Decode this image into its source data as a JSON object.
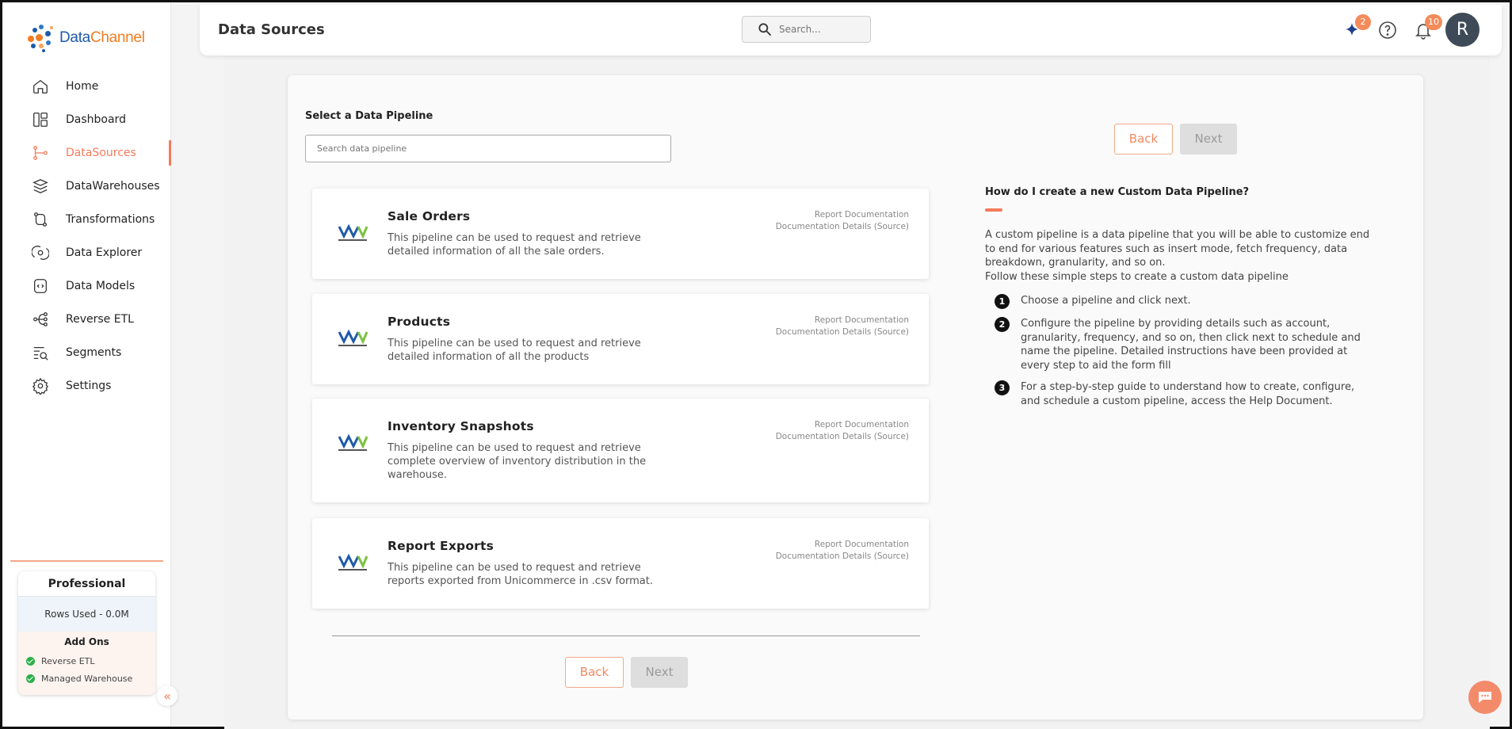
{
  "brand": {
    "name_part1": "Data",
    "name_part2": "Channel"
  },
  "header": {
    "title": "Data Sources",
    "search_placeholder": "Search...",
    "sparkle_badge": "2",
    "notification_badge": "10",
    "avatar_initial": "R"
  },
  "sidebar": {
    "items": [
      {
        "label": "Home",
        "icon": "home-icon"
      },
      {
        "label": "Dashboard",
        "icon": "dashboard-icon"
      },
      {
        "label": "DataSources",
        "icon": "datasources-icon",
        "active": true
      },
      {
        "label": "DataWarehouses",
        "icon": "warehouse-icon"
      },
      {
        "label": "Transformations",
        "icon": "transform-icon"
      },
      {
        "label": "Data Explorer",
        "icon": "explorer-icon"
      },
      {
        "label": "Data Models",
        "icon": "models-icon"
      },
      {
        "label": "Reverse ETL",
        "icon": "reverse-etl-icon"
      },
      {
        "label": "Segments",
        "icon": "segments-icon"
      },
      {
        "label": "Settings",
        "icon": "gear-icon"
      }
    ],
    "plan": {
      "name": "Professional",
      "rows_used": "Rows Used - 0.0M",
      "addons_title": "Add Ons",
      "addons": [
        "Reverse ETL",
        "Managed Warehouse"
      ]
    }
  },
  "main": {
    "select_label": "Select a Data Pipeline",
    "search_placeholder": "Search data pipeline",
    "back_label": "Back",
    "next_label": "Next",
    "cards": [
      {
        "title": "Sale Orders",
        "desc": "This pipeline can be used to request and retrieve detailed information of all the sale orders.",
        "link1": "Report Documentation",
        "link2": "Documentation Details (Source)"
      },
      {
        "title": "Products",
        "desc": "This pipeline can be used to request and retrieve detailed information of all the products",
        "link1": "Report Documentation",
        "link2": "Documentation Details (Source)"
      },
      {
        "title": "Inventory Snapshots",
        "desc": "This pipeline can be used to request and retrieve complete overview of inventory distribution in the warehouse.",
        "link1": "Report Documentation",
        "link2": "Documentation Details (Source)"
      },
      {
        "title": "Report Exports",
        "desc": "This pipeline can be used to request and retrieve reports exported from Unicommerce in .csv format.",
        "link1": "Report Documentation",
        "link2": "Documentation Details (Source)"
      }
    ]
  },
  "help": {
    "title": "How do I create a new Custom Data Pipeline?",
    "intro": "A custom pipeline is a data pipeline that you will be able to customize end to end for various features such as insert mode, fetch frequency, data breakdown, granularity, and so on.",
    "intro2": "Follow these simple steps to create a custom data pipeline",
    "steps": [
      {
        "num": "1",
        "text": "Choose a pipeline and click next."
      },
      {
        "num": "2",
        "text": "Configure the pipeline by providing details such as account, granularity, frequency, and so on, then click next to schedule and name the pipeline. Detailed instructions have been provided at every step to aid the form fill"
      },
      {
        "num": "3",
        "text": "For a step-by-step guide to understand how to create, configure, and schedule a custom pipeline, access the Help Document."
      }
    ]
  },
  "colors": {
    "accent": "#f47b5a",
    "brand_blue": "#1e5aa8",
    "brand_orange": "#f47b20"
  }
}
